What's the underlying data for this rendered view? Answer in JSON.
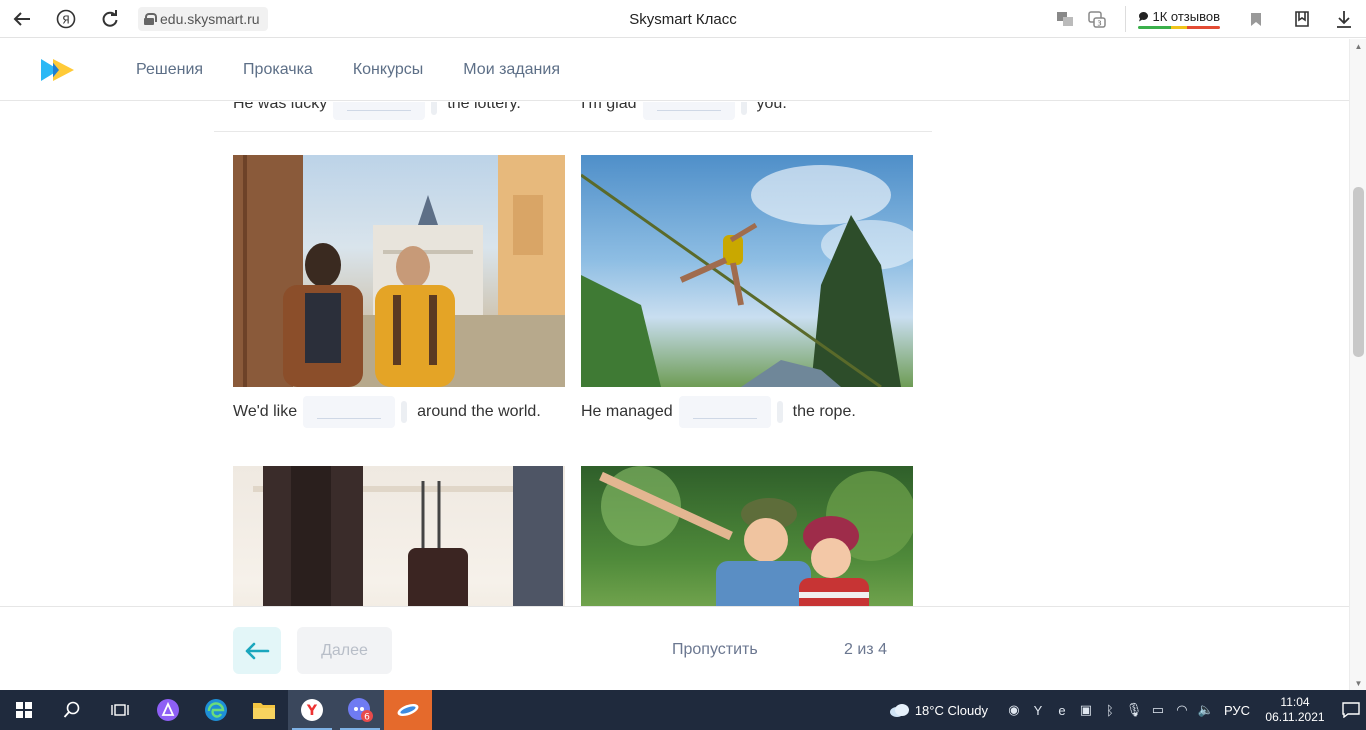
{
  "browser": {
    "url": "edu.skysmart.ru",
    "title": "Skysmart Класс",
    "reviews": "1К отзывов",
    "tab_badge": "3"
  },
  "header": {
    "nav": [
      "Решения",
      "Прокачка",
      "Конкурсы",
      "Мои задания"
    ],
    "brand_colors": [
      "#2ab8f5",
      "#ffc72c"
    ]
  },
  "exercise": {
    "prev_row": [
      {
        "before": "He was lucky",
        "after": "the lottery."
      },
      {
        "before": "I'm glad",
        "after": "you."
      }
    ],
    "cards": [
      {
        "before": "We'd like",
        "after": "around the world."
      },
      {
        "before": "He managed",
        "after": "the rope."
      },
      {
        "before": "",
        "after": ""
      },
      {
        "before": "",
        "after": ""
      }
    ]
  },
  "footer": {
    "next_label": "Далее",
    "skip_label": "Пропустить",
    "pager": "2 из 4"
  },
  "taskbar": {
    "weather": "18°C  Cloudy",
    "lang": "РУС",
    "time": "11:04",
    "date": "06.11.2021",
    "badge": "6"
  }
}
